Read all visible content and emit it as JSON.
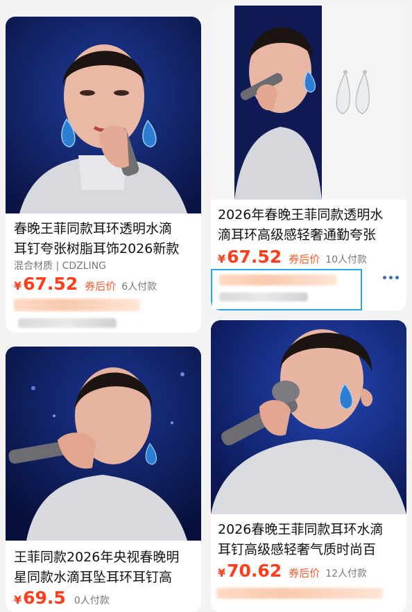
{
  "products": [
    {
      "title_line1": "春晚王菲同款耳环透明水滴",
      "title_line2": "耳钉夸张树脂耳饰2026新款",
      "material": "混合材质 | CDZLING",
      "currency": "¥",
      "price": "67.52",
      "after_coupon": "券后价",
      "paid": "6人付款"
    },
    {
      "title_line1": "2026年春晚王菲同款透明水",
      "title_line2": "滴耳环高级感轻奢通勤夸张",
      "currency": "¥",
      "price": "67.52",
      "after_coupon": "券后价",
      "paid": "10人付款"
    },
    {
      "title_line1": "王菲同款2026年央视春晚明",
      "title_line2": "星同款水滴耳坠耳环耳钉高",
      "currency": "¥",
      "price": "69.5",
      "paid": "0人付款"
    },
    {
      "title_line1": "2026春晚王菲同款耳环水滴",
      "title_line2": "耳钉高级感轻奢气质时尚百",
      "currency": "¥",
      "price": "70.62",
      "after_coupon": "券后价",
      "paid": "12人付款"
    }
  ],
  "colors": {
    "price": "#ff3d1a",
    "selection": "#2aa5e8",
    "more_dots": "#3a6fb7"
  },
  "icons": [
    "more-dots-icon"
  ]
}
